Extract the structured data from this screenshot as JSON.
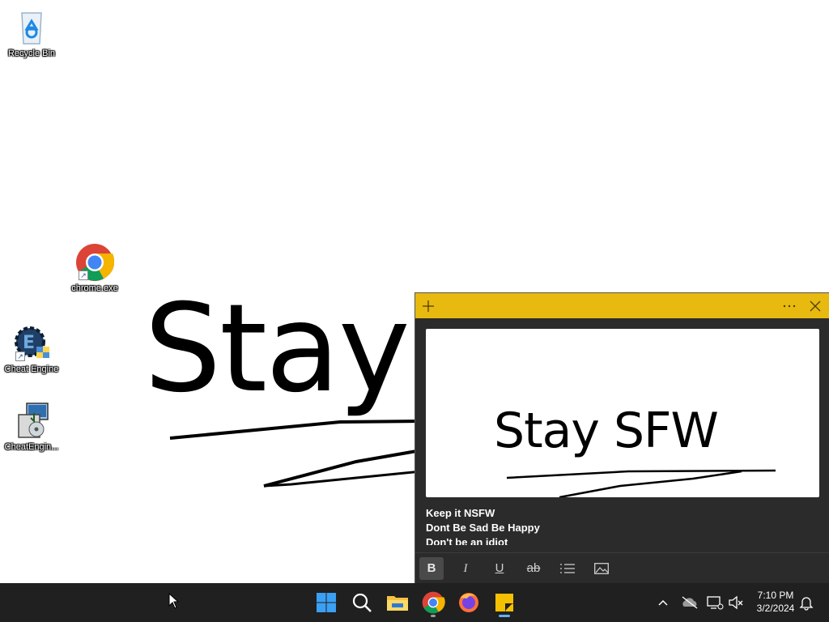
{
  "desktop": {
    "icons": [
      {
        "label": "Recycle Bin",
        "icon": "recycle-bin-icon"
      },
      {
        "label": "chrome.exe",
        "icon": "chrome-icon"
      },
      {
        "label": "Cheat Engine",
        "icon": "cheat-engine-icon"
      },
      {
        "label": "CheatEngin...",
        "icon": "installer-icon"
      }
    ],
    "wallpaper_text": "Stay S"
  },
  "sticky_note": {
    "header": {
      "add_icon": "plus-icon",
      "menu_icon": "more-icon",
      "close_icon": "close-icon"
    },
    "image_text": "Stay SFW",
    "lines": [
      "Keep it NSFW",
      "Dont Be Sad Be Happy",
      "Don't be an idiot"
    ],
    "toolbar": {
      "bold": "B",
      "italic": "I",
      "underline": "U",
      "strikethrough": "ab",
      "list_icon": "bulleted-list-icon",
      "image_icon": "add-image-icon"
    },
    "header_color": "#e8b90f"
  },
  "taskbar": {
    "apps": [
      "start-icon",
      "search-icon",
      "file-explorer-icon",
      "chrome-icon",
      "firefox-icon",
      "sticky-notes-icon"
    ],
    "tray": {
      "time": "7:10 PM",
      "date": "3/2/2024"
    }
  }
}
